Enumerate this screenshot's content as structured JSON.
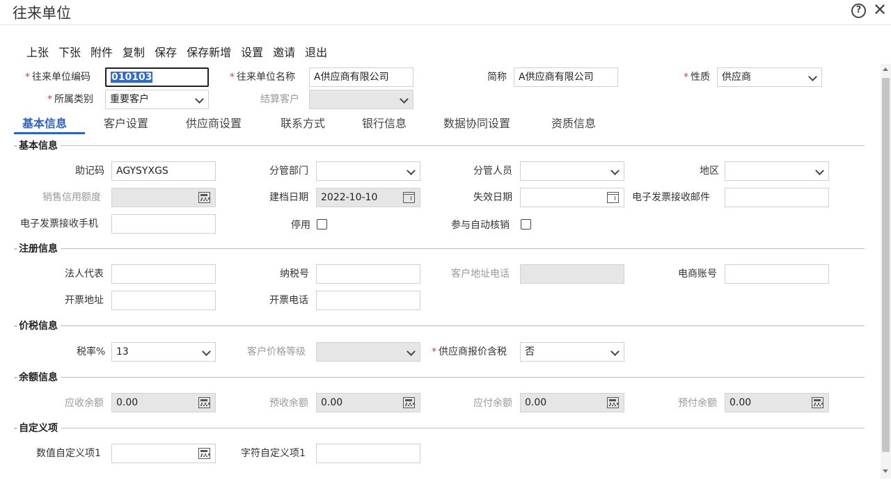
{
  "window": {
    "title": "往来单位",
    "help": "?",
    "close": "✕"
  },
  "toolbar": [
    "上张",
    "下张",
    "附件",
    "复制",
    "保存",
    "保存新增",
    "设置",
    "邀请",
    "退出"
  ],
  "header": {
    "code_label": "往来单位编码",
    "code_value": "010103",
    "name_label": "往来单位名称",
    "name_value": "A供应商有限公司",
    "short_label": "简称",
    "short_value": "A供应商有限公司",
    "nature_label": "性质",
    "nature_value": "供应商",
    "category_label": "所属类别",
    "category_value": "重要客户",
    "settle_label": "结算客户",
    "settle_value": ""
  },
  "tabs": [
    "基本信息",
    "客户设置",
    "供应商设置",
    "联系方式",
    "银行信息",
    "数据协同设置",
    "资质信息"
  ],
  "basic": {
    "title": "基本信息",
    "mnemonic_label": "助记码",
    "mnemonic_value": "AGYSYXGS",
    "dept_label": "分管部门",
    "dept_value": "",
    "staff_label": "分管人员",
    "staff_value": "",
    "region_label": "地区",
    "region_value": "",
    "credit_label": "销售信用额度",
    "credit_value": "",
    "create_date_label": "建档日期",
    "create_date_value": "2022-10-10",
    "expire_label": "失效日期",
    "expire_value": "",
    "einvoice_mail_label": "电子发票接收邮件",
    "einvoice_mail_value": "",
    "einvoice_phone_label": "电子发票接收手机",
    "einvoice_phone_value": "",
    "disabled_label": "停用",
    "auto_writeoff_label": "参与自动核销"
  },
  "registration": {
    "title": "注册信息",
    "legal_label": "法人代表",
    "taxno_label": "纳税号",
    "addr_phone_label": "客户地址电话",
    "ecom_label": "电商账号",
    "invoice_addr_label": "开票地址",
    "invoice_phone_label": "开票电话"
  },
  "tax": {
    "title": "价税信息",
    "rate_label": "税率%",
    "rate_value": "13",
    "price_level_label": "客户价格等级",
    "price_level_value": "",
    "quote_tax_label": "供应商报价含税",
    "quote_tax_value": "否"
  },
  "balance": {
    "title": "余额信息",
    "ar_label": "应收余额",
    "ar_value": "0.00",
    "adv_recv_label": "预收余额",
    "adv_recv_value": "0.00",
    "ap_label": "应付余额",
    "ap_value": "0.00",
    "adv_pay_label": "预付余额",
    "adv_pay_value": "0.00"
  },
  "custom": {
    "title": "自定义项",
    "num1_label": "数值自定义项1",
    "num1_value": "",
    "str1_label": "字符自定义项1",
    "str1_value": ""
  }
}
